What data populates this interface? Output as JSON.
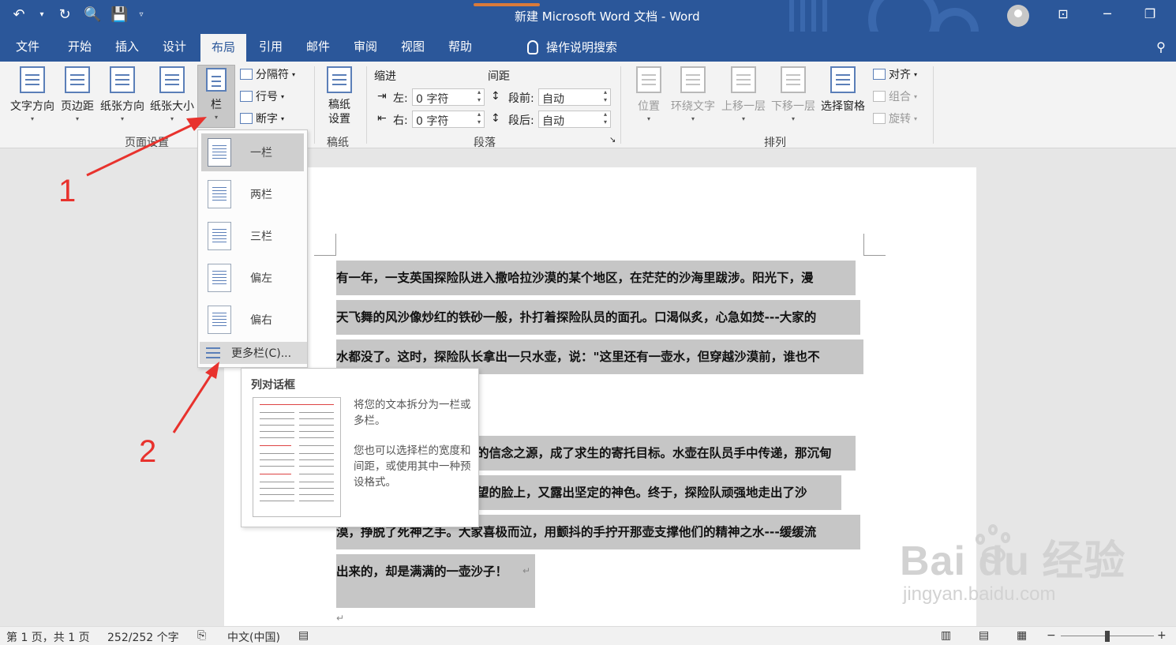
{
  "window": {
    "title": "新建 Microsoft Word 文档  -  Word"
  },
  "quick_access": [
    "undo-icon",
    "redo-icon",
    "print-preview-icon",
    "save-icon",
    "customize-icon"
  ],
  "tabs": [
    {
      "label": "文件"
    },
    {
      "label": "开始"
    },
    {
      "label": "插入"
    },
    {
      "label": "设计"
    },
    {
      "label": "布局",
      "active": true
    },
    {
      "label": "引用"
    },
    {
      "label": "邮件"
    },
    {
      "label": "审阅"
    },
    {
      "label": "视图"
    },
    {
      "label": "帮助"
    }
  ],
  "tell_me": "操作说明搜索",
  "ribbon": {
    "page_setup": {
      "label": "页面设置",
      "buttons": [
        "文字方向",
        "页边距",
        "纸张方向",
        "纸张大小",
        "栏"
      ],
      "small": [
        "分隔符",
        "行号",
        "断字"
      ]
    },
    "manuscript": {
      "label": "稿纸",
      "button": "稿纸设置"
    },
    "paragraph": {
      "label": "段落",
      "indent_title": "缩进",
      "spacing_title": "间距",
      "left_label": "左:",
      "right_label": "右:",
      "left_value": "0 字符",
      "right_value": "0 字符",
      "before_label": "段前:",
      "after_label": "段后:",
      "before_value": "自动",
      "after_value": "自动"
    },
    "arrange": {
      "label": "排列",
      "buttons": [
        "位置",
        "环绕文字",
        "上移一层",
        "下移一层",
        "选择窗格"
      ],
      "small": [
        "对齐",
        "组合",
        "旋转"
      ]
    }
  },
  "columns_menu": {
    "items": [
      "一栏",
      "两栏",
      "三栏",
      "偏左",
      "偏右"
    ],
    "selected": "一栏",
    "more": "更多栏(C)..."
  },
  "tooltip": {
    "title": "列对话框",
    "text1": "将您的文本拆分为一栏或多栏。",
    "text2": "您也可以选择栏的宽度和间距，或使用其中一种预设格式。"
  },
  "document": {
    "lines": [
      "有一年，一支英国探险队进入撒哈拉沙漠的某个地区，在茫茫的沙海里跋涉。阳光下，漫",
      "天飞舞的风沙像炒红的铁砂一般，扑打着探险队员的面孔。口渴似炙，心急如焚---大家的",
      "水都没了。这时，探险队长拿出一只水壶，说：\"这里还有一壶水，但穿越沙漠前，谁也不",
      "的信念之源，成了求生的寄托目标。水壶在队员手中传递，那沉甸",
      "望的脸上，又露出坚定的神色。终于，探险队顽强地走出了沙",
      "漠，挣脱了死神之手。大家喜极而泣，用颤抖的手拧开那壶支撑他们的精神之水---缓缓流",
      "出来的，却是满满的一壶沙子！"
    ]
  },
  "annotations": {
    "one": "1",
    "two": "2"
  },
  "watermark": {
    "brand": "Bai  du 经验",
    "url": "jingyan.baidu.com"
  },
  "status": {
    "page": "第 1 页，共 1 页",
    "words": "252/252 个字",
    "language": "中文(中国)"
  },
  "colors": {
    "title_bar": "#2b579a",
    "annotation": "#e8322d",
    "selection": "#c6c6c6"
  }
}
